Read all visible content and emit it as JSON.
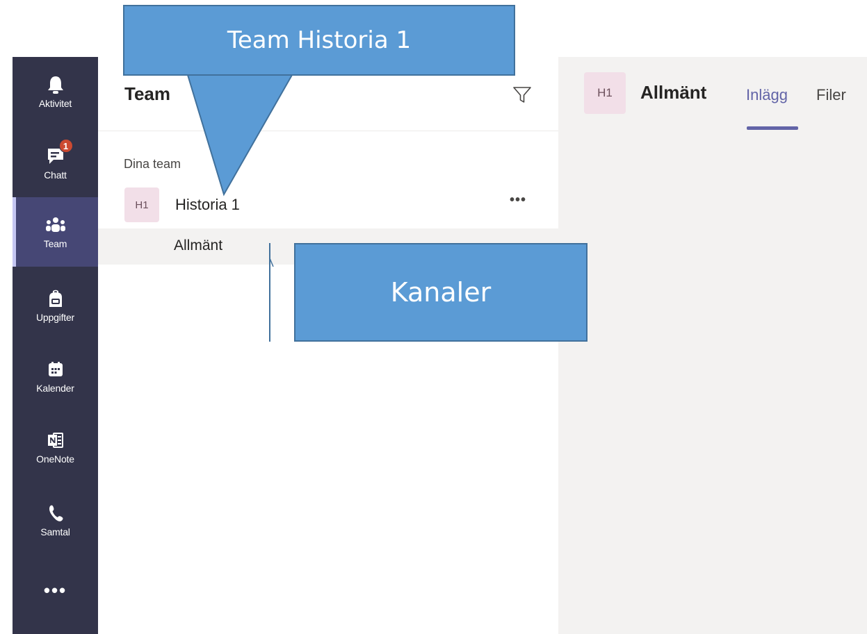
{
  "rail": {
    "items": [
      {
        "label": "Aktivitet",
        "icon": "bell-icon"
      },
      {
        "label": "Chatt",
        "icon": "chat-icon",
        "badge": "1"
      },
      {
        "label": "Team",
        "icon": "teams-icon"
      },
      {
        "label": "Uppgifter",
        "icon": "backpack-icon"
      },
      {
        "label": "Kalender",
        "icon": "calendar-icon"
      },
      {
        "label": "OneNote",
        "icon": "onenote-icon"
      },
      {
        "label": "Samtal",
        "icon": "phone-icon"
      }
    ],
    "more": "•••",
    "active": "Team"
  },
  "list": {
    "title": "Team",
    "section_label": "Dina team",
    "team": {
      "avatar": "H1",
      "name": "Historia 1",
      "more": "•••"
    },
    "channel": {
      "name": "Allmänt"
    }
  },
  "content": {
    "avatar": "H1",
    "title": "Allmänt",
    "tabs": [
      {
        "label": "Inlägg",
        "active": true
      },
      {
        "label": "Filer",
        "active": false
      }
    ]
  },
  "callouts": {
    "team": "Team Historia 1",
    "channels": "Kanaler"
  },
  "colors": {
    "rail": "#33344a",
    "rail_active": "#464775",
    "accent": "#6264a7",
    "badge": "#cc4a31",
    "callout": "#5b9bd5"
  }
}
